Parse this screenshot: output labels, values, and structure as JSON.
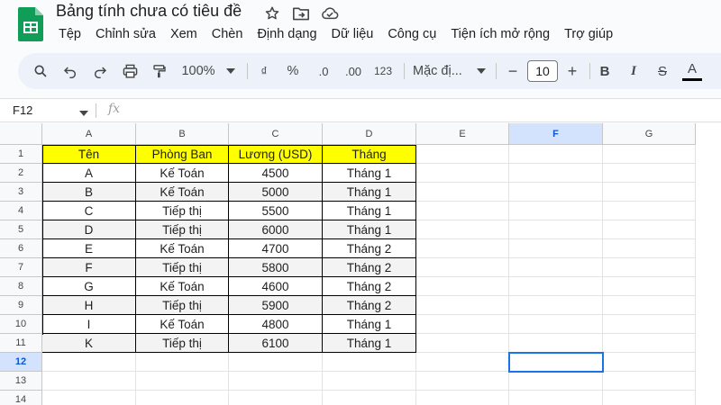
{
  "app": {
    "doc_title": "Bảng tính chưa có tiêu đề",
    "title_icons": [
      "star-icon",
      "move-to-folder-icon",
      "cloud-saved-icon"
    ]
  },
  "menu": [
    "Tệp",
    "Chỉnh sửa",
    "Xem",
    "Chèn",
    "Định dạng",
    "Dữ liệu",
    "Công cụ",
    "Tiện ích mở rộng",
    "Trợ giúp"
  ],
  "toolbar": {
    "zoom": "100%",
    "currency": "₫",
    "percent": "%",
    "decrease_decimal": ".0",
    "increase_decimal": ".00",
    "number_format": "123",
    "font": "Mặc đị...",
    "font_size": "10",
    "minus": "−",
    "plus": "+",
    "bold": "B",
    "italic": "I",
    "strike": "S",
    "text_color": "A",
    "text_color_value": "#000000"
  },
  "formula_bar": {
    "name_box": "F12",
    "fx": "fx"
  },
  "sheet": {
    "columns": [
      "A",
      "B",
      "C",
      "D",
      "E",
      "F",
      "G"
    ],
    "selected_column": "F",
    "selected_row": "12",
    "row_numbers": [
      "1",
      "2",
      "3",
      "4",
      "5",
      "6",
      "7",
      "8",
      "9",
      "10",
      "11",
      "12",
      "13",
      "14"
    ],
    "header": [
      "Tên",
      "Phòng Ban",
      "Lương (USD)",
      "Tháng"
    ],
    "rows": [
      [
        "A",
        "Kế Toán",
        "4500",
        "Tháng 1"
      ],
      [
        "B",
        "Kế Toán",
        "5000",
        "Tháng 1"
      ],
      [
        "C",
        "Tiếp thị",
        "5500",
        "Tháng 1"
      ],
      [
        "D",
        "Tiếp thị",
        "6000",
        "Tháng 1"
      ],
      [
        "E",
        "Kế Toán",
        "4700",
        "Tháng 2"
      ],
      [
        "F",
        "Tiếp thị",
        "5800",
        "Tháng 2"
      ],
      [
        "G",
        "Kế Toán",
        "4600",
        "Tháng 2"
      ],
      [
        "H",
        "Tiếp thị",
        "5900",
        "Tháng 2"
      ],
      [
        "I",
        "Kế Toán",
        "4800",
        "Tháng 1"
      ],
      [
        "K",
        "Tiếp thị",
        "6100",
        "Tháng 1"
      ]
    ],
    "header_fill": "#ffff00",
    "alt_row_fill": "#f3f3f3",
    "selection_color": "#1a73e8"
  }
}
